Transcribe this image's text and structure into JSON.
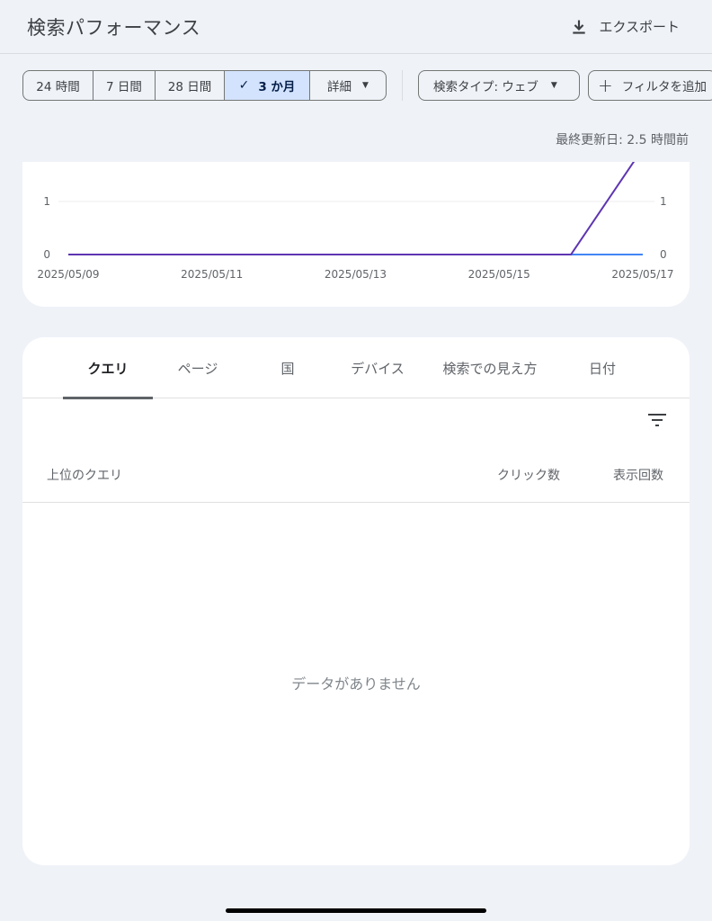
{
  "header": {
    "title": "検索パフォーマンス",
    "export_label": "エクスポート"
  },
  "date_range": {
    "options": [
      "24 時間",
      "7 日間",
      "28 日間",
      "3 か月",
      "詳細"
    ],
    "selected": "3 か月"
  },
  "filters": {
    "search_type": "検索タイプ: ウェブ",
    "add_filter": "フィルタを追加"
  },
  "last_updated": "最終更新日: 2.5 時間前",
  "chart_data": {
    "type": "line",
    "x": [
      "2025/05/09",
      "2025/05/10",
      "2025/05/11",
      "2025/05/12",
      "2025/05/13",
      "2025/05/14",
      "2025/05/15",
      "2025/05/16",
      "2025/05/17"
    ],
    "x_tick_labels": [
      "2025/05/09",
      "2025/05/11",
      "2025/05/13",
      "2025/05/15",
      "2025/05/17"
    ],
    "y_left_ticks": [
      "0",
      "1"
    ],
    "y_right_ticks": [
      "0",
      "1"
    ],
    "series": [
      {
        "color": "#4285f4",
        "values": [
          0,
          0,
          0,
          0,
          0,
          0,
          0,
          0,
          0
        ]
      },
      {
        "color": "#5e35b1",
        "values": [
          0,
          0,
          0,
          0,
          0,
          0,
          0,
          0,
          2
        ]
      }
    ],
    "ylim": [
      0,
      1
    ]
  },
  "tabs": [
    "クエリ",
    "ページ",
    "国",
    "デバイス",
    "検索での見え方",
    "日付"
  ],
  "active_tab": "クエリ",
  "table": {
    "columns": [
      "上位のクエリ",
      "クリック数",
      "表示回数"
    ],
    "empty_message": "データがありません"
  }
}
